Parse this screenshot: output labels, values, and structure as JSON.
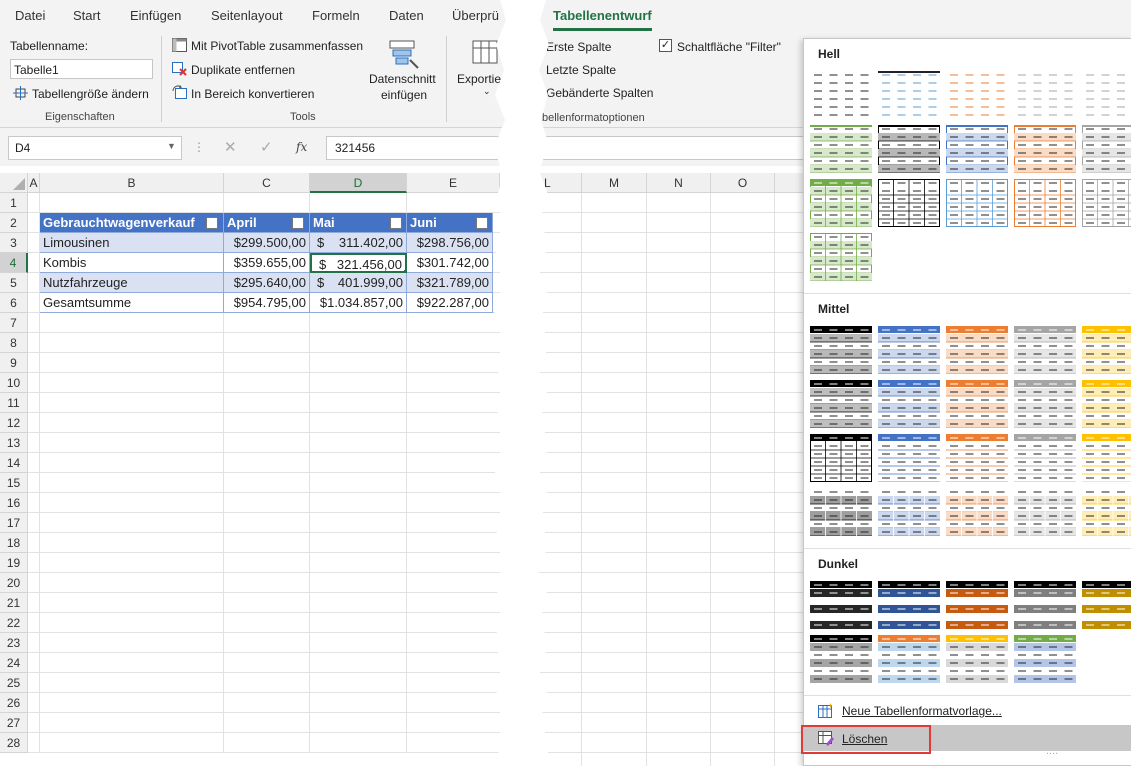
{
  "left": {
    "tabs": [
      "Datei",
      "Start",
      "Einfügen",
      "Seitenlayout",
      "Formeln",
      "Daten",
      "Überprü"
    ],
    "eigenschaften": {
      "name_label": "Tabellenname:",
      "name_value": "Tabelle1",
      "resize_label": "Tabellengröße ändern",
      "group_label": "Eigenschaften"
    },
    "tools": {
      "pivot": "Mit PivotTable zusammenfassen",
      "dupes": "Duplikate entfernen",
      "convert": "In Bereich konvertieren",
      "slicer_l1": "Datenschnitt",
      "slicer_l2": "einfügen",
      "group_label": "Tools"
    },
    "export": {
      "label": "Exportie"
    },
    "formula": {
      "namebox": "D4",
      "fx": "fx",
      "value": "321456"
    },
    "columns": [
      "A",
      "B",
      "C",
      "D",
      "E"
    ],
    "rows": [
      "1",
      "2",
      "3",
      "4",
      "5",
      "6",
      "7",
      "8",
      "9",
      "10",
      "11",
      "12",
      "13",
      "14",
      "15",
      "16",
      "17",
      "18",
      "19",
      "20",
      "21",
      "22",
      "23",
      "24",
      "25",
      "26",
      "27",
      "28"
    ],
    "table": {
      "headers": [
        "Gebrauchtwagenverkauf",
        "April",
        "Mai",
        "Juni"
      ],
      "data": [
        [
          "Limousinen",
          "$299.500,00",
          "$",
          "311.402,00",
          "$298.756,00"
        ],
        [
          "Kombis",
          "$359.655,00",
          "$",
          "321.456,00",
          "$301.742,00"
        ],
        [
          "Nutzfahrzeuge",
          "$295.640,00",
          "$",
          "401.999,00",
          "$321.789,00"
        ],
        [
          "Gesamtsumme",
          "$954.795,00",
          "$1.034.857,00",
          "",
          "$922.287,00"
        ]
      ]
    }
  },
  "right": {
    "tab": "Tabellenentwurf",
    "options": {
      "first_col": "Erste Spalte",
      "last_col": "Letzte Spalte",
      "banded_cols": "Gebänderte Spalten",
      "filter_button": "Schaltfläche \"Filter\"",
      "group_label": "bellenformatoptionen"
    },
    "columns": [
      "L",
      "M",
      "N",
      "O"
    ],
    "gallery": {
      "light": "Hell",
      "medium": "Mittel",
      "dark": "Dunkel",
      "new_style": "Neue Tabellenformatvorlage...",
      "clear": "Löschen",
      "more": "...."
    },
    "colors": {
      "accent_green": "#217346",
      "blue": "#4472c4",
      "orange": "#ed7d31",
      "gray": "#a5a5a5",
      "gold": "#ffc000",
      "lightblue": "#5b9bd5",
      "green": "#70ad47",
      "highlight_red": "#e03a3a"
    }
  }
}
